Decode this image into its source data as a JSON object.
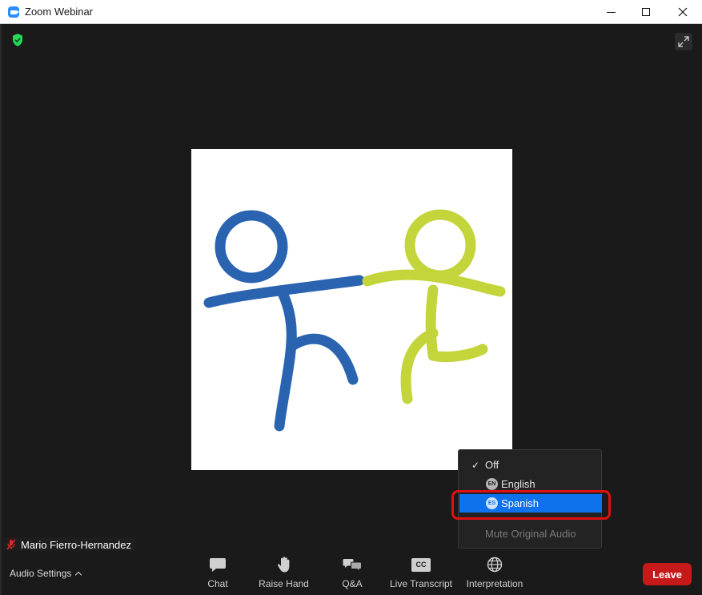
{
  "window": {
    "title": "Zoom Webinar"
  },
  "icons": {
    "app": "zoom-camera-icon",
    "security": "shield-check-icon",
    "fullscreen": "expand-arrows-icon",
    "muted_mic": "muted-microphone-icon",
    "chat": "chat-bubble-icon",
    "raise_hand": "hand-icon",
    "qa": "qa-bubbles-icon",
    "live_transcript": "closed-caption-icon",
    "interpretation": "globe-icon"
  },
  "participant": {
    "name": "Mario Fierro-Hernandez"
  },
  "interpretation_menu": {
    "items": [
      {
        "label": "Off",
        "checked": true
      },
      {
        "badge": "EN",
        "label": "English"
      },
      {
        "badge": "ES",
        "label": "Spanish",
        "highlighted": true
      }
    ],
    "mute_original": "Mute Original Audio"
  },
  "toolbar": {
    "audio_settings": "Audio Settings",
    "chat": "Chat",
    "raise_hand": "Raise Hand",
    "qa": "Q&A",
    "live_transcript": "Live Transcript",
    "cc_badge": "CC",
    "interpretation": "Interpretation",
    "leave": "Leave"
  },
  "colors": {
    "leave": "#c61a1a",
    "highlight_ring": "#e01010",
    "selected_item": "#0e72ed",
    "logo_blue": "#2a63b0",
    "logo_green": "#c3d53a",
    "security_green": "#23d959"
  }
}
